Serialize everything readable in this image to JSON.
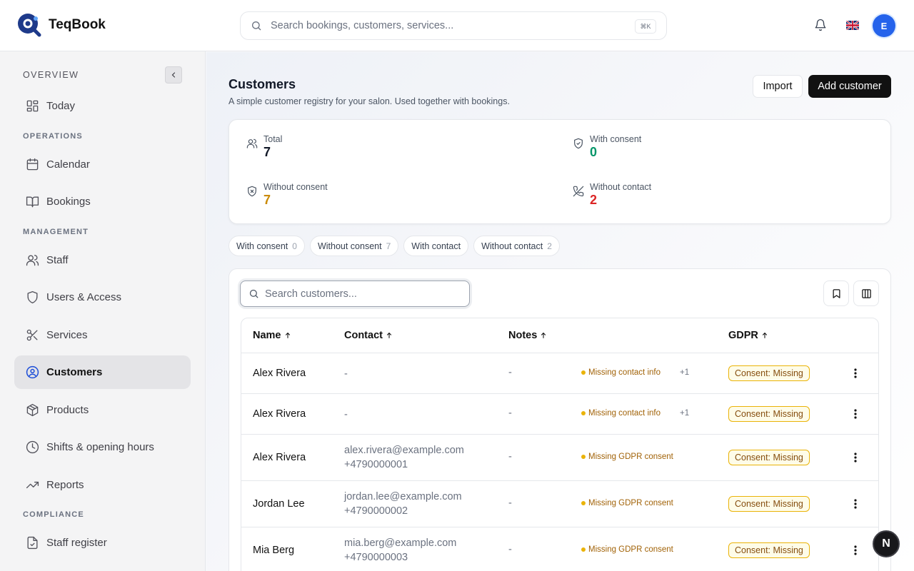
{
  "app": {
    "name": "TeqBook"
  },
  "header": {
    "search_placeholder": "Search bookings, customers, services...",
    "shortcut": "⌘K",
    "user_initial": "E",
    "language_flag": "uk-flag-icon"
  },
  "sidebar": {
    "overview_label": "OVERVIEW",
    "operations_label": "OPERATIONS",
    "management_label": "MANAGEMENT",
    "compliance_label": "COMPLIANCE",
    "items": [
      {
        "label": "Today",
        "icon": "dashboard-icon"
      },
      {
        "label": "Calendar",
        "icon": "calendar-icon"
      },
      {
        "label": "Bookings",
        "icon": "book-open-icon"
      },
      {
        "label": "Staff",
        "icon": "users-icon"
      },
      {
        "label": "Users & Access",
        "icon": "shield-icon"
      },
      {
        "label": "Services",
        "icon": "scissors-icon"
      },
      {
        "label": "Customers",
        "icon": "user-circle-icon",
        "active": true
      },
      {
        "label": "Products",
        "icon": "package-icon"
      },
      {
        "label": "Shifts & opening hours",
        "icon": "clock-icon"
      },
      {
        "label": "Reports",
        "icon": "trending-up-icon"
      },
      {
        "label": "Staff register",
        "icon": "file-check-icon"
      }
    ]
  },
  "page": {
    "title": "Customers",
    "subtitle": "A simple customer registry for your salon. Used together with bookings.",
    "import_label": "Import",
    "add_label": "Add customer"
  },
  "stats": {
    "total": {
      "label": "Total",
      "value": "7",
      "color": "#111827"
    },
    "with_consent": {
      "label": "With consent",
      "value": "0",
      "color": "#059669"
    },
    "without_consent": {
      "label": "Without consent",
      "value": "7",
      "color": "#ca8a04"
    },
    "without_contact": {
      "label": "Without contact",
      "value": "2",
      "color": "#dc2626"
    }
  },
  "filters": [
    {
      "label": "With consent",
      "count": "0"
    },
    {
      "label": "Without consent",
      "count": "7"
    },
    {
      "label": "With contact",
      "count": ""
    },
    {
      "label": "Without contact",
      "count": "2"
    }
  ],
  "table": {
    "search_placeholder": "Search customers...",
    "columns": {
      "name": "Name",
      "contact": "Contact",
      "notes": "Notes",
      "gdpr": "GDPR"
    },
    "rows": [
      {
        "name": "Alex Rivera",
        "email": "-",
        "phone": "",
        "notes": "-",
        "issue": "Missing contact info",
        "more": "+1",
        "gdpr": "Consent: Missing"
      },
      {
        "name": "Alex Rivera",
        "email": "-",
        "phone": "",
        "notes": "-",
        "issue": "Missing contact info",
        "more": "+1",
        "gdpr": "Consent: Missing"
      },
      {
        "name": "Alex Rivera",
        "email": "alex.rivera@example.com",
        "phone": "+4790000001",
        "notes": "-",
        "issue": "Missing GDPR consent",
        "more": "",
        "gdpr": "Consent: Missing"
      },
      {
        "name": "Jordan Lee",
        "email": "jordan.lee@example.com",
        "phone": "+4790000002",
        "notes": "-",
        "issue": "Missing GDPR consent",
        "more": "",
        "gdpr": "Consent: Missing"
      },
      {
        "name": "Mia Berg",
        "email": "mia.berg@example.com",
        "phone": "+4790000003",
        "notes": "-",
        "issue": "Missing GDPR consent",
        "more": "",
        "gdpr": "Consent: Missing"
      }
    ]
  },
  "fab_label": "N"
}
